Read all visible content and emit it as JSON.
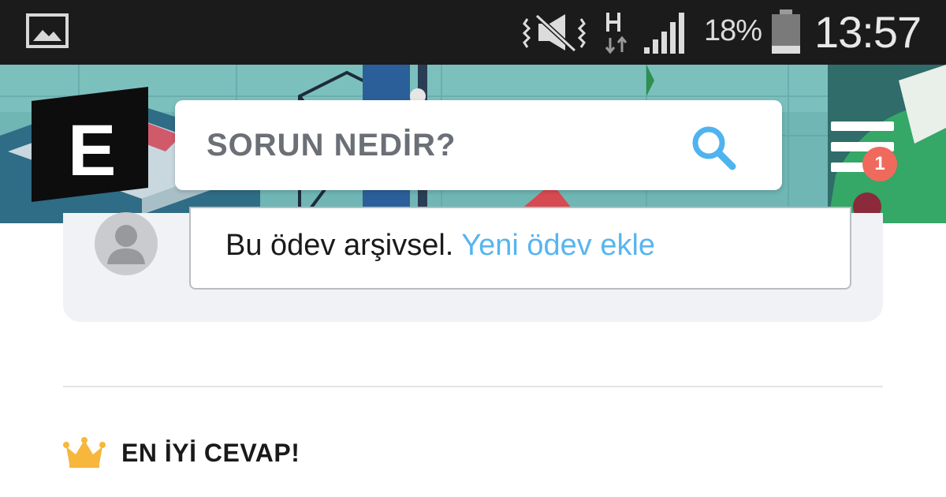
{
  "status_bar": {
    "icons": [
      "image-icon",
      "mute-vibrate-icon",
      "network-h-icon",
      "signal-icon",
      "battery-icon"
    ],
    "battery_percent": "18%",
    "time": "13:57"
  },
  "header": {
    "logo_letter": "E",
    "search": {
      "placeholder": "SORUN NEDİR?"
    },
    "menu": {
      "notification_count": "1"
    }
  },
  "comment": {
    "archived_text": "Bu ödev arşivsel.",
    "new_link": "Yeni ödev ekle"
  },
  "best_answer": {
    "label": "EN İYİ CEVAP!"
  },
  "colors": {
    "status_bar": "#1b1b1b",
    "header_teal": "#6db5b3",
    "link_blue": "#57b5f0",
    "badge_red": "#ef6a5d",
    "crown_gold": "#f6b73c",
    "card_bg": "#f0f2f5"
  }
}
